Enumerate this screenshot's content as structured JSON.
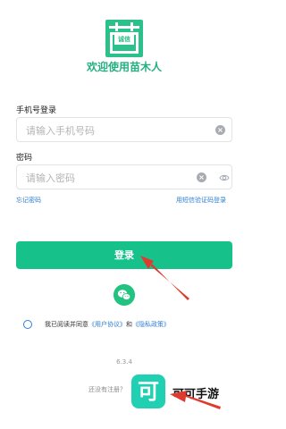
{
  "app": {
    "logo_badge": "诚信",
    "welcome": "欢迎使用苗木人"
  },
  "phone": {
    "label": "手机号登录",
    "placeholder": "请输入手机号码",
    "value": ""
  },
  "password": {
    "label": "密码",
    "placeholder": "请输入密码",
    "value": ""
  },
  "links": {
    "forgot": "忘记密码",
    "sms_login": "用短信验证码登录"
  },
  "login_button": "登录",
  "agreement": {
    "prefix": "我已阅读并同意",
    "user_agreement": "《用户协议》",
    "and": "和",
    "privacy_policy": "《隐私政策》"
  },
  "version": "6.3.4",
  "register": {
    "prompt": "还没有注册？"
  },
  "watermark": {
    "icon_char": "可",
    "text": "可可手游"
  },
  "colors": {
    "brand": "#16c28a",
    "link": "#2e7fd4",
    "annotation_arrow": "#e03a2f"
  },
  "icons": [
    "clear-icon",
    "eye-icon",
    "wechat-icon",
    "radio-icon"
  ]
}
